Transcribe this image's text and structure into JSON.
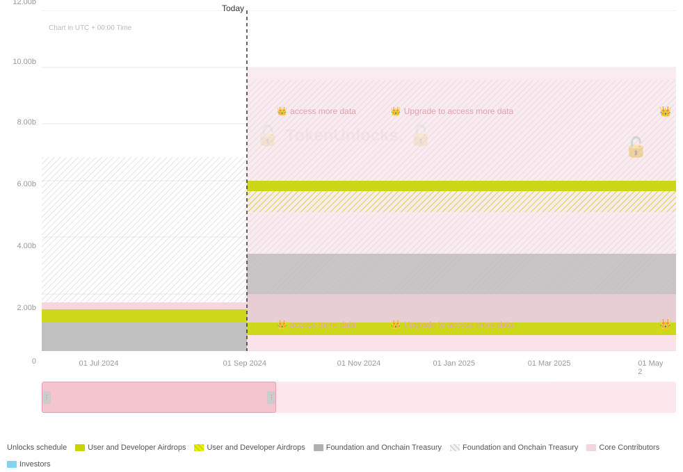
{
  "chart": {
    "title": "Unlocks schedule",
    "utc_label": "Chart in UTC + 00:00 Time",
    "today_label": "Today",
    "y_axis": {
      "labels": [
        "0",
        "2.00b",
        "4.00b",
        "6.00b",
        "8.00b",
        "10.00b",
        "12.00b"
      ]
    },
    "x_axis": {
      "labels": [
        "01 Jul 2024",
        "01 Sep 2024",
        "01 Nov 2024",
        "01 Jan 2025",
        "01 Mar 2025",
        "01 May 2"
      ]
    },
    "upgrade_messages": [
      "access more data",
      "Upgrade to access more data"
    ],
    "watermark": "TokenUnlocks."
  },
  "legend": {
    "items": [
      {
        "id": "unlocks-schedule",
        "label": "Unlocks schedule",
        "type": "text-only"
      },
      {
        "id": "user-developer-airdrops-solid",
        "label": "User and Developer Airdrops",
        "color": "#c8d400",
        "type": "solid"
      },
      {
        "id": "user-developer-airdrops-hatched",
        "label": "User and Developer Airdrops",
        "color": "hatched-yellow",
        "type": "hatched"
      },
      {
        "id": "foundation-onchain-treasury-solid",
        "label": "Foundation and Onchain Treasury",
        "color": "#b0b0b0",
        "type": "solid"
      },
      {
        "id": "foundation-onchain-treasury-hatched",
        "label": "Foundation and Onchain Treasury",
        "color": "hatched-gray",
        "type": "hatched"
      },
      {
        "id": "core-contributors",
        "label": "Core Contributors",
        "color": "#f5d5dc",
        "type": "solid"
      },
      {
        "id": "investors",
        "label": "Investors",
        "color": "#80d4f0",
        "type": "solid"
      }
    ]
  },
  "upgrade_overlay": {
    "icon": "👑",
    "messages": [
      "access more data",
      "Upgrade to access more data"
    ]
  }
}
